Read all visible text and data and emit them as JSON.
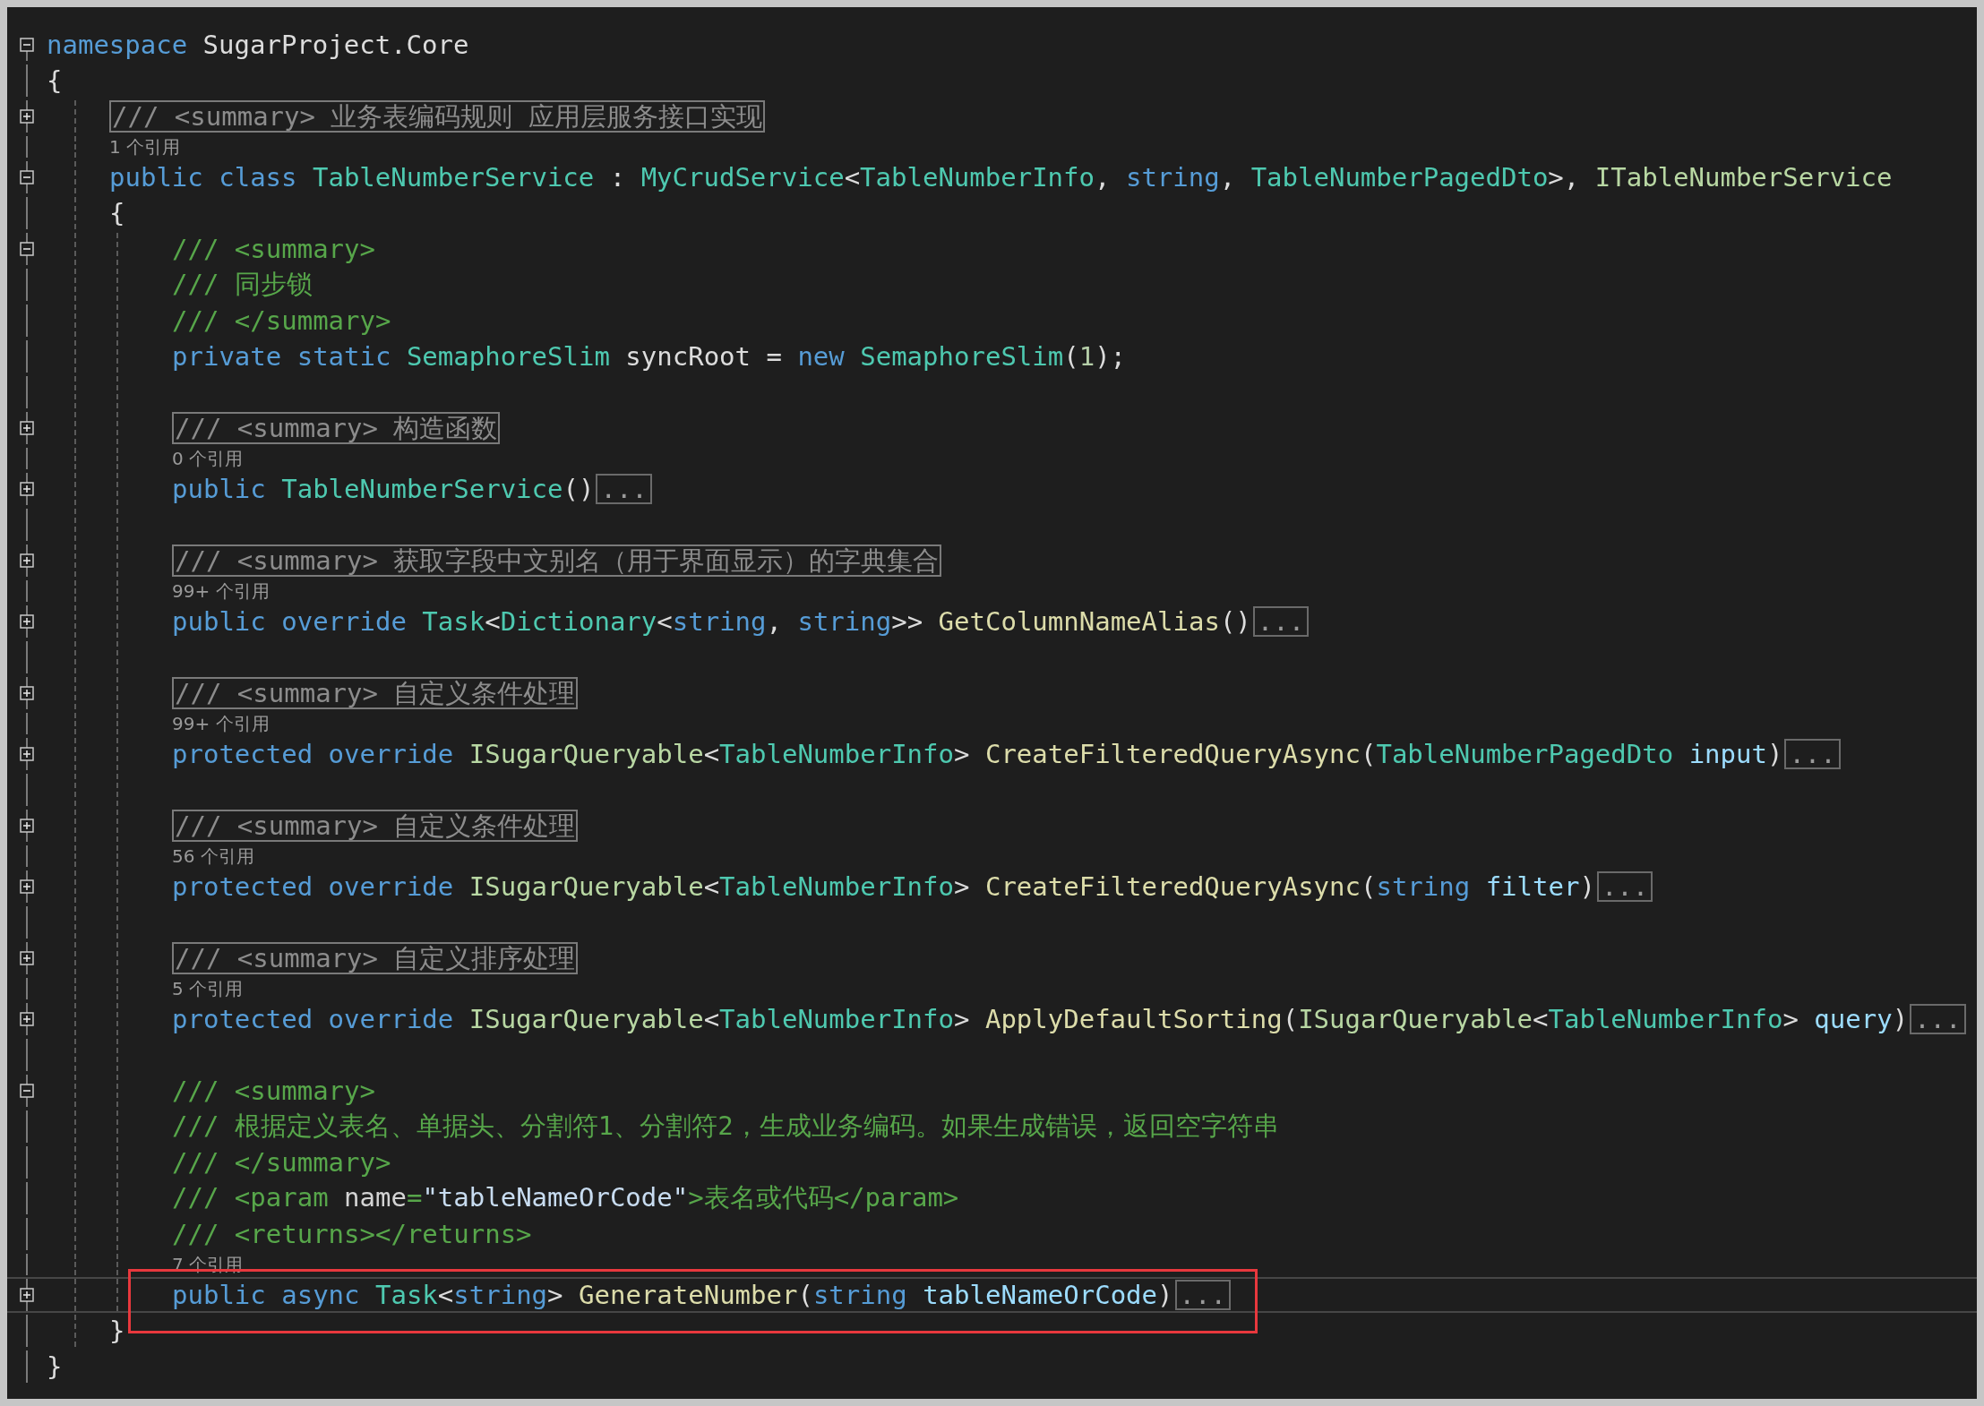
{
  "editor": {
    "lines": [
      {
        "kind": "code",
        "collapsed": false,
        "tokens": [
          {
            "text": "namespace",
            "kind": "kw"
          },
          {
            "text": " SugarProject.Core",
            "kind": "plain"
          }
        ]
      },
      {
        "kind": "brace",
        "text": "{",
        "children": [
          {
            "kind": "summary",
            "collapsed": true,
            "text": "/// <summary> 业务表编码规则 应用层服务接口实现"
          },
          {
            "kind": "codelens",
            "text": "1 个引用"
          },
          {
            "kind": "code",
            "collapsed": false,
            "tokens": [
              {
                "text": "public",
                "kind": "kw"
              },
              {
                "text": " class",
                "kind": "kw"
              },
              {
                "text": " TableNumberService",
                "kind": "type"
              },
              {
                "text": " : ",
                "kind": "plain"
              },
              {
                "text": "MyCrudService",
                "kind": "type"
              },
              {
                "text": "<",
                "kind": "plain"
              },
              {
                "text": "TableNumberInfo",
                "kind": "type"
              },
              {
                "text": ", ",
                "kind": "plain"
              },
              {
                "text": "string",
                "kind": "kw"
              },
              {
                "text": ", ",
                "kind": "plain"
              },
              {
                "text": "TableNumberPagedDto",
                "kind": "type"
              },
              {
                "text": ">, ",
                "kind": "plain"
              },
              {
                "text": "ITableNumberService",
                "kind": "iface"
              }
            ]
          },
          {
            "kind": "brace",
            "text": "{",
            "children": [
              {
                "kind": "code",
                "collapsed": false,
                "tokens": [
                  {
                    "text": "/// <summary>",
                    "kind": "doc"
                  }
                ]
              },
              {
                "kind": "code",
                "tokens": [
                  {
                    "text": "/// 同步锁",
                    "kind": "doc"
                  }
                ]
              },
              {
                "kind": "code",
                "tokens": [
                  {
                    "text": "/// </summary>",
                    "kind": "doc"
                  }
                ]
              },
              {
                "kind": "code",
                "tokens": [
                  {
                    "text": "private",
                    "kind": "kw"
                  },
                  {
                    "text": " static",
                    "kind": "kw"
                  },
                  {
                    "text": " SemaphoreSlim",
                    "kind": "type"
                  },
                  {
                    "text": " syncRoot = ",
                    "kind": "plain"
                  },
                  {
                    "text": "new",
                    "kind": "kw"
                  },
                  {
                    "text": " SemaphoreSlim",
                    "kind": "type"
                  },
                  {
                    "text": "(",
                    "kind": "plain"
                  },
                  {
                    "text": "1",
                    "kind": "num"
                  },
                  {
                    "text": ");",
                    "kind": "plain"
                  }
                ]
              },
              {
                "kind": "blank"
              },
              {
                "kind": "summary",
                "collapsed": true,
                "text": "/// <summary> 构造函数"
              },
              {
                "kind": "codelens",
                "text": "0 个引用"
              },
              {
                "kind": "code",
                "collapsed": true,
                "ellipsis": "...",
                "tokens": [
                  {
                    "text": "public",
                    "kind": "kw"
                  },
                  {
                    "text": " TableNumberService",
                    "kind": "type"
                  },
                  {
                    "text": "()",
                    "kind": "plain"
                  }
                ]
              },
              {
                "kind": "blank"
              },
              {
                "kind": "summary",
                "collapsed": true,
                "text": "/// <summary> 获取字段中文别名（用于界面显示）的字典集合"
              },
              {
                "kind": "codelens",
                "text": "99+ 个引用"
              },
              {
                "kind": "code",
                "collapsed": true,
                "ellipsis": "...",
                "tokens": [
                  {
                    "text": "public",
                    "kind": "kw"
                  },
                  {
                    "text": " override",
                    "kind": "kw"
                  },
                  {
                    "text": " Task",
                    "kind": "type"
                  },
                  {
                    "text": "<",
                    "kind": "plain"
                  },
                  {
                    "text": "Dictionary",
                    "kind": "type"
                  },
                  {
                    "text": "<",
                    "kind": "plain"
                  },
                  {
                    "text": "string",
                    "kind": "kw"
                  },
                  {
                    "text": ", ",
                    "kind": "plain"
                  },
                  {
                    "text": "string",
                    "kind": "kw"
                  },
                  {
                    "text": ">> ",
                    "kind": "plain"
                  },
                  {
                    "text": "GetColumnNameAlias",
                    "kind": "method"
                  },
                  {
                    "text": "()",
                    "kind": "plain"
                  }
                ]
              },
              {
                "kind": "blank"
              },
              {
                "kind": "summary",
                "collapsed": true,
                "text": "/// <summary> 自定义条件处理"
              },
              {
                "kind": "codelens",
                "text": "99+ 个引用"
              },
              {
                "kind": "code",
                "collapsed": true,
                "ellipsis": "...",
                "tokens": [
                  {
                    "text": "protected",
                    "kind": "kw"
                  },
                  {
                    "text": " override",
                    "kind": "kw"
                  },
                  {
                    "text": " ISugarQueryable",
                    "kind": "iface"
                  },
                  {
                    "text": "<",
                    "kind": "plain"
                  },
                  {
                    "text": "TableNumberInfo",
                    "kind": "type"
                  },
                  {
                    "text": "> ",
                    "kind": "plain"
                  },
                  {
                    "text": "CreateFilteredQueryAsync",
                    "kind": "method"
                  },
                  {
                    "text": "(",
                    "kind": "plain"
                  },
                  {
                    "text": "TableNumberPagedDto",
                    "kind": "type"
                  },
                  {
                    "text": " input",
                    "kind": "param"
                  },
                  {
                    "text": ")",
                    "kind": "plain"
                  }
                ]
              },
              {
                "kind": "blank"
              },
              {
                "kind": "summary",
                "collapsed": true,
                "text": "/// <summary> 自定义条件处理"
              },
              {
                "kind": "codelens",
                "text": "56 个引用"
              },
              {
                "kind": "code",
                "collapsed": true,
                "ellipsis": "...",
                "tokens": [
                  {
                    "text": "protected",
                    "kind": "kw"
                  },
                  {
                    "text": " override",
                    "kind": "kw"
                  },
                  {
                    "text": " ISugarQueryable",
                    "kind": "iface"
                  },
                  {
                    "text": "<",
                    "kind": "plain"
                  },
                  {
                    "text": "TableNumberInfo",
                    "kind": "type"
                  },
                  {
                    "text": "> ",
                    "kind": "plain"
                  },
                  {
                    "text": "CreateFilteredQueryAsync",
                    "kind": "method"
                  },
                  {
                    "text": "(",
                    "kind": "plain"
                  },
                  {
                    "text": "string",
                    "kind": "kw"
                  },
                  {
                    "text": " filter",
                    "kind": "param"
                  },
                  {
                    "text": ")",
                    "kind": "plain"
                  }
                ]
              },
              {
                "kind": "blank"
              },
              {
                "kind": "summary",
                "collapsed": true,
                "text": "/// <summary> 自定义排序处理"
              },
              {
                "kind": "codelens",
                "text": "5 个引用"
              },
              {
                "kind": "code",
                "collapsed": true,
                "ellipsis": "...",
                "tokens": [
                  {
                    "text": "protected",
                    "kind": "kw"
                  },
                  {
                    "text": " override",
                    "kind": "kw"
                  },
                  {
                    "text": " ISugarQueryable",
                    "kind": "iface"
                  },
                  {
                    "text": "<",
                    "kind": "plain"
                  },
                  {
                    "text": "TableNumberInfo",
                    "kind": "type"
                  },
                  {
                    "text": "> ",
                    "kind": "plain"
                  },
                  {
                    "text": "ApplyDefaultSorting",
                    "kind": "method"
                  },
                  {
                    "text": "(",
                    "kind": "plain"
                  },
                  {
                    "text": "ISugarQueryable",
                    "kind": "iface"
                  },
                  {
                    "text": "<",
                    "kind": "plain"
                  },
                  {
                    "text": "TableNumberInfo",
                    "kind": "type"
                  },
                  {
                    "text": "> ",
                    "kind": "plain"
                  },
                  {
                    "text": "query",
                    "kind": "param"
                  },
                  {
                    "text": ")",
                    "kind": "plain"
                  }
                ]
              },
              {
                "kind": "blank"
              },
              {
                "kind": "code",
                "collapsed": false,
                "tokens": [
                  {
                    "text": "/// <summary>",
                    "kind": "doc"
                  }
                ]
              },
              {
                "kind": "code",
                "tokens": [
                  {
                    "text": "/// 根据定义表名、单据头、分割符1、分割符2，生成业务编码。如果生成错误，返回空字符串",
                    "kind": "doc"
                  }
                ]
              },
              {
                "kind": "code",
                "tokens": [
                  {
                    "text": "/// </summary>",
                    "kind": "doc"
                  }
                ]
              },
              {
                "kind": "code",
                "tokens": [
                  {
                    "text": "/// <param ",
                    "kind": "doc"
                  },
                  {
                    "text": "name",
                    "kind": "docattr"
                  },
                  {
                    "text": "=",
                    "kind": "doc"
                  },
                  {
                    "text": "\"tableNameOrCode\"",
                    "kind": "docstr"
                  },
                  {
                    "text": ">表名或代码</param>",
                    "kind": "doc"
                  }
                ]
              },
              {
                "kind": "code",
                "tokens": [
                  {
                    "text": "/// <returns></returns>",
                    "kind": "doc"
                  }
                ]
              },
              {
                "kind": "codelens",
                "text": "7 个引用"
              },
              {
                "kind": "code",
                "collapsed": true,
                "ellipsis": "...",
                "current": true,
                "highlighted": true,
                "tokens": [
                  {
                    "text": "public",
                    "kind": "kw"
                  },
                  {
                    "text": " async",
                    "kind": "kw"
                  },
                  {
                    "text": " Task",
                    "kind": "type"
                  },
                  {
                    "text": "<",
                    "kind": "plain"
                  },
                  {
                    "text": "string",
                    "kind": "kw"
                  },
                  {
                    "text": "> ",
                    "kind": "plain"
                  },
                  {
                    "text": "GenerateNumber",
                    "kind": "method"
                  },
                  {
                    "text": "(",
                    "kind": "plain"
                  },
                  {
                    "text": "string",
                    "kind": "kw"
                  },
                  {
                    "text": " tableNameOrCode",
                    "kind": "param"
                  },
                  {
                    "text": ")",
                    "kind": "plain"
                  }
                ]
              }
            ]
          },
          {
            "kind": "brace",
            "text": "}"
          }
        ]
      },
      {
        "kind": "brace",
        "text": "}"
      }
    ]
  }
}
